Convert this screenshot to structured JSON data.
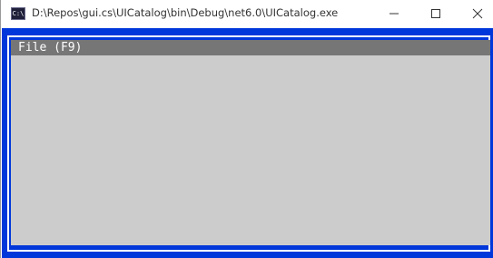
{
  "window": {
    "title": "D:\\Repos\\gui.cs\\UICatalog\\bin\\Debug\\net6.0\\UICatalog.exe",
    "app_icon": "console-app-icon",
    "app_icon_text": "C:\\",
    "controls": [
      "minimize-icon",
      "maximize-icon",
      "close-icon"
    ]
  },
  "menubar": {
    "items": [
      {
        "label": "File (F9)"
      }
    ]
  },
  "colors": {
    "console_background": "#0037da",
    "frame_border": "#ffffff",
    "content_background": "#cccccc",
    "menubar_background": "#767676",
    "menu_text": "#ffffff"
  }
}
